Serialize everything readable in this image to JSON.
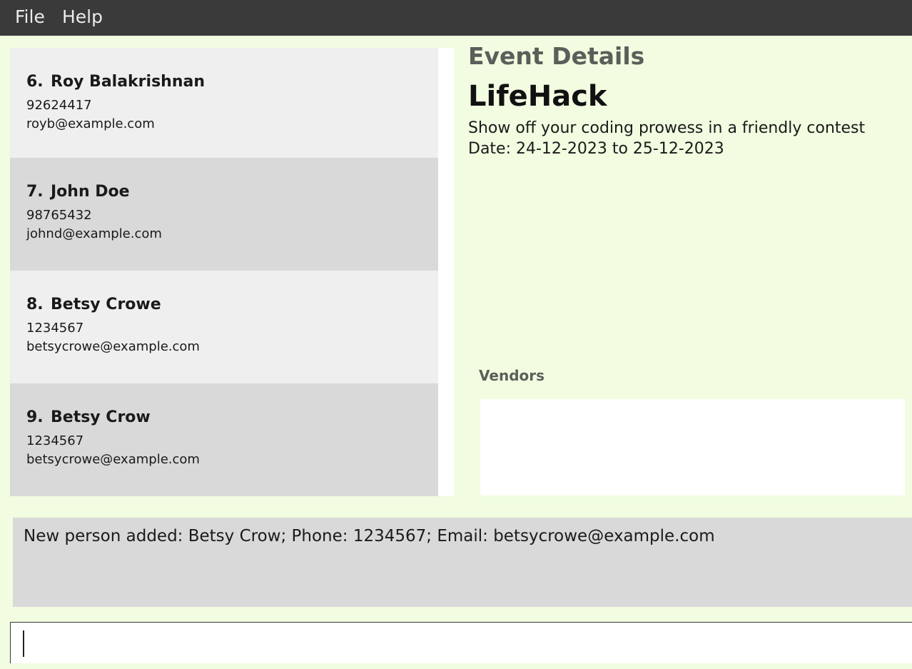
{
  "menu": {
    "file_label": "File",
    "help_label": "Help"
  },
  "persons": [
    {
      "index": "6.",
      "name": "Roy Balakrishnan",
      "phone": "92624417",
      "email": "royb@example.com"
    },
    {
      "index": "7.",
      "name": "John Doe",
      "phone": "98765432",
      "email": "johnd@example.com"
    },
    {
      "index": "8.",
      "name": "Betsy Crowe",
      "phone": "1234567",
      "email": "betsycrowe@example.com"
    },
    {
      "index": "9.",
      "name": "Betsy Crow",
      "phone": "1234567",
      "email": "betsycrowe@example.com"
    }
  ],
  "event": {
    "heading": "Event Details",
    "name": "LifeHack",
    "description": "Show off your coding prowess in a friendly contest",
    "dates": "Date: 24-12-2023 to 25-12-2023"
  },
  "vendors": {
    "heading": "Vendors"
  },
  "result": {
    "message": "New person added: Betsy Crow; Phone: 1234567; Email: betsycrowe@example.com"
  },
  "command": {
    "value": ""
  },
  "colors": {
    "background": "#f1fce0",
    "menubar": "#3a3a3a",
    "card_odd": "#efefef",
    "card_even": "#d9d9d9"
  }
}
